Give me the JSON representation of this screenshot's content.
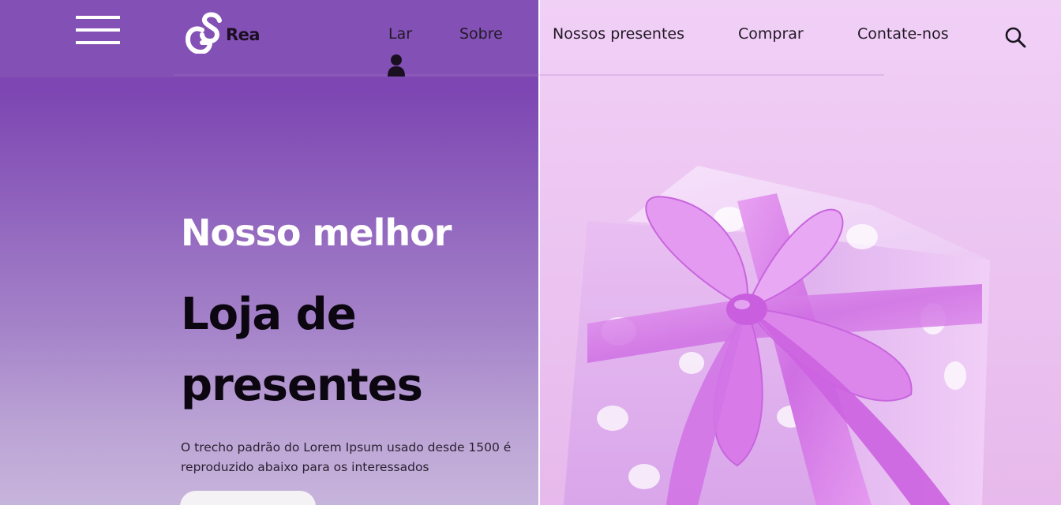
{
  "header": {
    "logo_text": "Rea",
    "logo_mark_letters": "GS",
    "nav": [
      {
        "label": "Lar"
      },
      {
        "label": "Sobre"
      },
      {
        "label": "Nossos presentes"
      },
      {
        "label": "Comprar"
      },
      {
        "label": "Contate-nos"
      }
    ],
    "icons": {
      "menu": "hamburger-menu-icon",
      "user": "user-icon",
      "search": "search-icon"
    }
  },
  "hero": {
    "subtitle": "Nosso melhor",
    "title_line1": "Loja de",
    "title_line2": "presentes",
    "description": "O trecho padrão do Lorem Ipsum usado desde 1500 é reproduzido abaixo para os interessados",
    "button_label": ""
  },
  "colors": {
    "panel_purple": "#7c44b1",
    "panel_light": "#c7b4dc",
    "gift_pink": "#efc8f0",
    "ribbon": "#d27de6",
    "heading_white": "#ffffff",
    "heading_dark": "#0b0610"
  }
}
